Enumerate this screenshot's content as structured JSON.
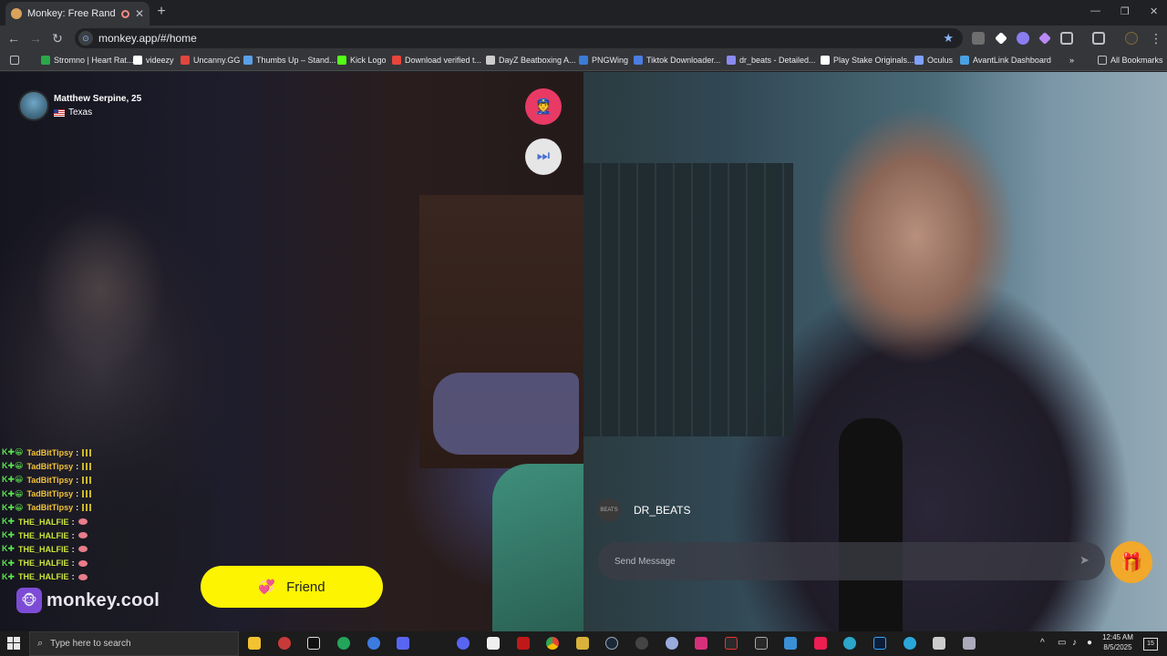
{
  "browser": {
    "tab_title": "Monkey: Free Random Vide",
    "tab_close": "✕",
    "new_tab": "+",
    "url": "monkey.app/#/home",
    "window_controls": [
      "—",
      "❐",
      "✕"
    ],
    "bookmarks": [
      {
        "label": "Stromno | Heart Rat...",
        "color": "#2aa84a"
      },
      {
        "label": "videezy",
        "color": "#ffffff"
      },
      {
        "label": "Uncanny.GG",
        "color": "#e0463e"
      },
      {
        "label": "Thumbs Up – Stand...",
        "color": "#5aa0e8"
      },
      {
        "label": "Kick Logo",
        "color": "#53fc18"
      },
      {
        "label": "Download verified t...",
        "color": "#e8453c"
      },
      {
        "label": "DayZ Beatboxing A...",
        "color": "#cccccc"
      },
      {
        "label": "PNGWing",
        "color": "#3a7bd5"
      },
      {
        "label": "Tiktok Downloader...",
        "color": "#4a7de0"
      },
      {
        "label": "dr_beats - Detailed...",
        "color": "#8a8af0"
      },
      {
        "label": "Play Stake Originals...",
        "color": "#ffffff"
      },
      {
        "label": "Oculus",
        "color": "#7fa0ff"
      },
      {
        "label": "AvantLink Dashboard",
        "color": "#4aa0e0"
      }
    ],
    "more_bookmarks": "»",
    "all_bookmarks": "All Bookmarks"
  },
  "remote_user": {
    "name": "Matthew Serpine, 25",
    "location": "Texas"
  },
  "chat_feed": [
    {
      "user": "TadBitTipsy",
      "color": "#f2c33a",
      "type": "bars"
    },
    {
      "user": "TadBitTipsy",
      "color": "#f2c33a",
      "type": "bars"
    },
    {
      "user": "TadBitTipsy",
      "color": "#f2c33a",
      "type": "bars"
    },
    {
      "user": "TadBitTipsy",
      "color": "#f2c33a",
      "type": "bars"
    },
    {
      "user": "TadBitTipsy",
      "color": "#f2c33a",
      "type": "bars"
    },
    {
      "user": "THE_HALFIE",
      "color": "#cde63c",
      "type": "lips"
    },
    {
      "user": "THE_HALFIE",
      "color": "#cde63c",
      "type": "lips"
    },
    {
      "user": "THE_HALFIE",
      "color": "#cde63c",
      "type": "lips"
    },
    {
      "user": "THE_HALFIE",
      "color": "#cde63c",
      "type": "lips"
    },
    {
      "user": "THE_HALFIE",
      "color": "#cde63c",
      "type": "lips"
    }
  ],
  "chat_separator": ":",
  "brand": {
    "name": "monkey.cool"
  },
  "friend_button": {
    "label": "Friend"
  },
  "chat": {
    "username": "DR_BEATS",
    "avatar_text": "BEATS",
    "message_placeholder": "Send Message"
  },
  "icons": {
    "report": "police-officer-icon",
    "skip": "next-track-icon",
    "gift": "gift-icon",
    "send": "send-icon"
  },
  "taskbar": {
    "search_placeholder": "Type here to search",
    "time": "12:45 AM",
    "date": "8/5/2025",
    "notifications": "15"
  },
  "colors": {
    "accent_yellow": "#fcf400",
    "report_red": "#e83a64",
    "brand_purple": "#7d4cd6",
    "gift_orange": "#f2a82a"
  }
}
